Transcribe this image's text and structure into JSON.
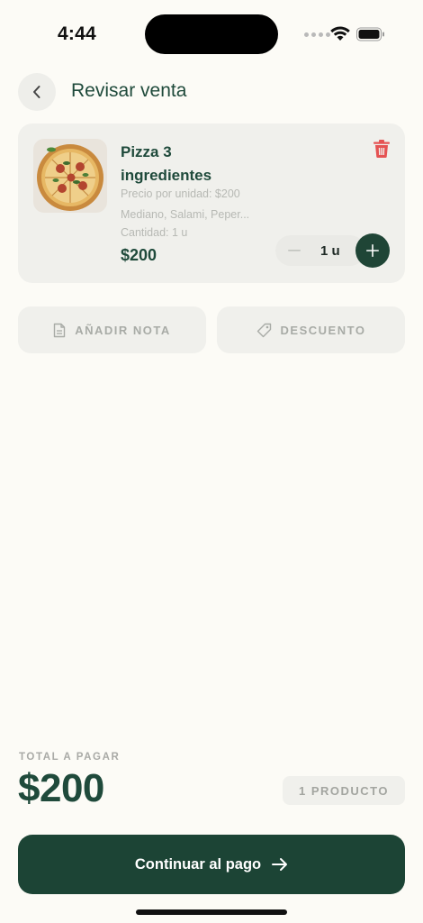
{
  "status_bar": {
    "time": "4:44"
  },
  "header": {
    "title": "Revisar venta"
  },
  "product": {
    "name_line1": "Pizza 3",
    "name_line2": "ingredientes",
    "unit_price": "Precio por unidad: $200",
    "options": "Mediano, Salami, Peper...",
    "quantity_text": "Cantidad: 1 u",
    "price": "$200",
    "qty_value": "1 u"
  },
  "actions": {
    "note_label": "AÑADIR NOTA",
    "discount_label": "DESCUENTO"
  },
  "footer": {
    "total_label": "TOTAL A PAGAR",
    "total_amount": "$200",
    "product_count": "1 PRODUCTO",
    "cta_label": "Continuar al pago"
  },
  "colors": {
    "background": "#fcfbf6",
    "brand_green": "#1f4a3b",
    "delete_red": "#e55353"
  },
  "icons": [
    "chevron-left-icon",
    "trash-icon",
    "minus-icon",
    "plus-icon",
    "document-icon",
    "tag-icon",
    "arrow-right-icon",
    "wifi-icon",
    "battery-icon"
  ]
}
